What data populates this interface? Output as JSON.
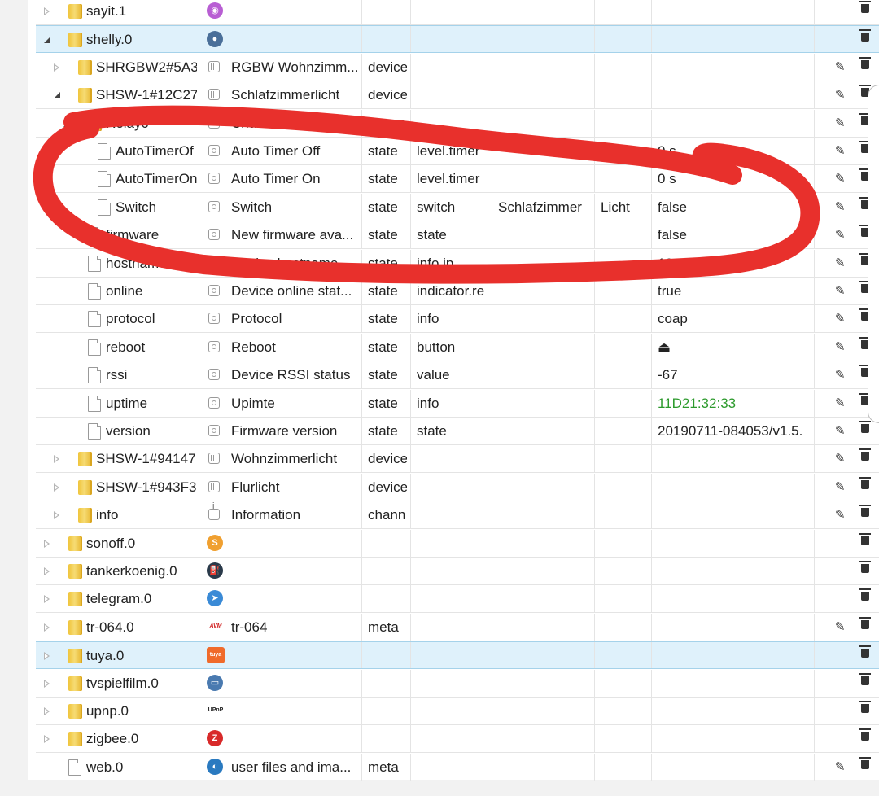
{
  "rows": [
    {
      "indent": 0,
      "toggle": "closed",
      "icon": "folder",
      "name": "sayit.1",
      "aicon": "sayit-icon",
      "aicolor": "#b85ed3",
      "desc": "",
      "type": "",
      "role": "",
      "room": "",
      "func": "",
      "value": "",
      "edit": false,
      "wrench": false
    },
    {
      "indent": 0,
      "toggle": "open",
      "icon": "folder",
      "name": "shelly.0",
      "aicon": "shelly-icon",
      "aicolor": "#4a6f99",
      "desc": "",
      "type": "",
      "role": "",
      "room": "",
      "func": "",
      "value": "",
      "edit": false,
      "wrench": false,
      "selected": true
    },
    {
      "indent": 1,
      "toggle": "closed",
      "icon": "folder",
      "name": "SHRGBW2#5A3",
      "sicon": "device",
      "desc": "RGBW Wohnzimm...",
      "type": "device",
      "role": "",
      "room": "",
      "func": "",
      "value": "",
      "edit": true,
      "wrench": false
    },
    {
      "indent": 1,
      "toggle": "open",
      "icon": "folder",
      "name": "SHSW-1#12C27",
      "sicon": "device",
      "desc": "Schlafzimmerlicht",
      "type": "device",
      "role": "",
      "room": "",
      "func": "",
      "value": "",
      "edit": true,
      "wrench": false
    },
    {
      "indent": 2,
      "toggle": "open",
      "icon": "folder",
      "name": "Relay0",
      "sicon": "channel",
      "desc": "Channel Relay0",
      "type": "chann",
      "role": "",
      "room": "",
      "func": "",
      "value": "",
      "edit": true,
      "wrench": false
    },
    {
      "indent": 3,
      "toggle": "",
      "icon": "file",
      "name": "AutoTimerOf",
      "sicon": "state",
      "desc": "Auto Timer Off",
      "type": "state",
      "role": "level.timer",
      "room": "",
      "func": "",
      "value": "0 s",
      "edit": true,
      "wrench": true
    },
    {
      "indent": 3,
      "toggle": "",
      "icon": "file",
      "name": "AutoTimerOn",
      "sicon": "state",
      "desc": "Auto Timer On",
      "type": "state",
      "role": "level.timer",
      "room": "",
      "func": "",
      "value": "0 s",
      "edit": true,
      "wrench": true
    },
    {
      "indent": 3,
      "toggle": "",
      "icon": "file",
      "name": "Switch",
      "sicon": "state",
      "desc": "Switch",
      "type": "state",
      "role": "switch",
      "room": "Schlafzimmer",
      "func": "Licht",
      "value": "false",
      "edit": true,
      "wrench": true
    },
    {
      "indent": 2,
      "toggle": "",
      "icon": "file",
      "name": "firmware",
      "sicon": "state",
      "desc": "New firmware ava...",
      "type": "state",
      "role": "state",
      "room": "",
      "func": "",
      "value": "false",
      "edit": true,
      "wrench": true
    },
    {
      "indent": 2,
      "toggle": "",
      "icon": "file",
      "name": "hostname",
      "sicon": "state",
      "desc": "Device hostname",
      "type": "state",
      "role": "info.ip",
      "room": "",
      "func": "",
      "value": "192.168.",
      "edit": true,
      "wrench": true
    },
    {
      "indent": 2,
      "toggle": "",
      "icon": "file",
      "name": "online",
      "sicon": "state",
      "desc": "Device online stat...",
      "type": "state",
      "role": "indicator.re",
      "room": "",
      "func": "",
      "value": "true",
      "edit": true,
      "wrench": true
    },
    {
      "indent": 2,
      "toggle": "",
      "icon": "file",
      "name": "protocol",
      "sicon": "state",
      "desc": "Protocol",
      "type": "state",
      "role": "info",
      "room": "",
      "func": "",
      "value": "coap",
      "edit": true,
      "wrench": true
    },
    {
      "indent": 2,
      "toggle": "",
      "icon": "file",
      "name": "reboot",
      "sicon": "state",
      "desc": "Reboot",
      "type": "state",
      "role": "button",
      "room": "",
      "func": "",
      "value": "⏏",
      "edit": true,
      "wrench": true
    },
    {
      "indent": 2,
      "toggle": "",
      "icon": "file",
      "name": "rssi",
      "sicon": "state",
      "desc": "Device RSSI status",
      "type": "state",
      "role": "value",
      "room": "",
      "func": "",
      "value": "-67",
      "edit": true,
      "wrench": true
    },
    {
      "indent": 2,
      "toggle": "",
      "icon": "file",
      "name": "uptime",
      "sicon": "state",
      "desc": "Upimte",
      "type": "state",
      "role": "info",
      "room": "",
      "func": "",
      "value": "11D21:32:33",
      "valueGreen": true,
      "edit": true,
      "wrench": true
    },
    {
      "indent": 2,
      "toggle": "",
      "icon": "file",
      "name": "version",
      "sicon": "state",
      "desc": "Firmware version",
      "type": "state",
      "role": "state",
      "room": "",
      "func": "",
      "value": "20190711-084053/v1.5.",
      "edit": true,
      "wrench": true
    },
    {
      "indent": 1,
      "toggle": "closed",
      "icon": "folder",
      "name": "SHSW-1#94147",
      "sicon": "device",
      "desc": "Wohnzimmerlicht",
      "type": "device",
      "role": "",
      "room": "",
      "func": "",
      "value": "",
      "edit": true,
      "wrench": false
    },
    {
      "indent": 1,
      "toggle": "closed",
      "icon": "folder",
      "name": "SHSW-1#943F3",
      "sicon": "device",
      "desc": "Flurlicht",
      "type": "device",
      "role": "",
      "room": "",
      "func": "",
      "value": "",
      "edit": true,
      "wrench": false
    },
    {
      "indent": 1,
      "toggle": "closed",
      "icon": "folder",
      "name": "info",
      "sicon": "channel",
      "desc": "Information",
      "type": "chann",
      "role": "",
      "room": "",
      "func": "",
      "value": "",
      "edit": true,
      "wrench": false
    },
    {
      "indent": 0,
      "toggle": "closed",
      "icon": "folder",
      "name": "sonoff.0",
      "aicon": "sonoff-icon",
      "aicolor": "#f0a030",
      "desc": "",
      "type": "",
      "role": "",
      "room": "",
      "func": "",
      "value": "",
      "edit": false,
      "wrench": false
    },
    {
      "indent": 0,
      "toggle": "closed",
      "icon": "folder",
      "name": "tankerkoenig.0",
      "aicon": "fuel-pump-icon",
      "aicolor": "#2a3a4a",
      "desc": "",
      "type": "",
      "role": "",
      "room": "",
      "func": "",
      "value": "",
      "edit": false,
      "wrench": false
    },
    {
      "indent": 0,
      "toggle": "closed",
      "icon": "folder",
      "name": "telegram.0",
      "aicon": "telegram-icon",
      "aicolor": "#3a8ad6",
      "desc": "",
      "type": "",
      "role": "",
      "room": "",
      "func": "",
      "value": "",
      "edit": false,
      "wrench": false
    },
    {
      "indent": 0,
      "toggle": "closed",
      "icon": "folder",
      "name": "tr-064.0",
      "aicon": "avm-icon",
      "aicolor": "#d12020",
      "desc": "tr-064",
      "type": "meta",
      "role": "",
      "room": "",
      "func": "",
      "value": "",
      "edit": true,
      "wrench": false
    },
    {
      "indent": 0,
      "toggle": "closed",
      "icon": "folder",
      "name": "tuya.0",
      "aicon": "tuya-icon",
      "aicolor": "#f06a2a",
      "desc": "",
      "type": "",
      "role": "",
      "room": "",
      "func": "",
      "value": "",
      "edit": false,
      "wrench": false,
      "selected": true
    },
    {
      "indent": 0,
      "toggle": "closed",
      "icon": "folder",
      "name": "tvspielfilm.0",
      "aicon": "tv-icon",
      "aicolor": "#4a7ab0",
      "desc": "",
      "type": "",
      "role": "",
      "room": "",
      "func": "",
      "value": "",
      "edit": false,
      "wrench": false
    },
    {
      "indent": 0,
      "toggle": "closed",
      "icon": "folder",
      "name": "upnp.0",
      "aicon": "upnp-icon",
      "aicolor": "#222222",
      "desc": "",
      "type": "",
      "role": "",
      "room": "",
      "func": "",
      "value": "",
      "edit": false,
      "wrench": false
    },
    {
      "indent": 0,
      "toggle": "closed",
      "icon": "folder",
      "name": "zigbee.0",
      "aicon": "zigbee-icon",
      "aicolor": "#d82a2a",
      "desc": "",
      "type": "",
      "role": "",
      "room": "",
      "func": "",
      "value": "",
      "edit": false,
      "wrench": false
    },
    {
      "indent": 0,
      "toggle": "",
      "icon": "file",
      "name": "web.0",
      "aicon": "web-icon",
      "aicolor": "#2a7ac0",
      "desc": "user files and ima...",
      "type": "meta",
      "role": "",
      "room": "",
      "func": "",
      "value": "",
      "edit": true,
      "wrench": false
    }
  ],
  "annotation": {
    "color": "#e8302c"
  }
}
